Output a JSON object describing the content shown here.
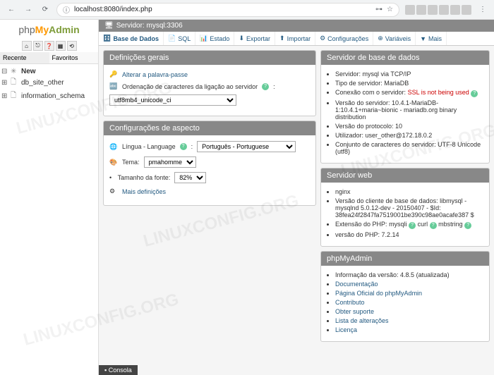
{
  "browser": {
    "url": "localhost:8080/index.php"
  },
  "logo": {
    "php": "php",
    "my": "My",
    "admin": "Admin"
  },
  "sidebar_tabs": {
    "recent": "Recente",
    "favorites": "Favoritos"
  },
  "tree": {
    "new": "New",
    "db1": "db_site_other",
    "db2": "information_schema"
  },
  "server_header": "Servidor: mysql:3306",
  "menu": {
    "databases": "Base de Dados",
    "sql": "SQL",
    "status": "Estado",
    "export": "Exportar",
    "import": "Importar",
    "settings": "Configurações",
    "variables": "Variáveis",
    "more": "Mais"
  },
  "general": {
    "title": "Definições gerais",
    "change_password": "Alterar a palavra-passe",
    "collation_label": "Ordenação de caracteres da ligação ao servidor",
    "collation_value": "utf8mb4_unicode_ci"
  },
  "appearance": {
    "title": "Configurações de aspecto",
    "language_label": "Língua - Language",
    "language_value": "Português - Portuguese",
    "theme_label": "Tema:",
    "theme_value": "pmahomme",
    "fontsize_label": "Tamanho da fonte:",
    "fontsize_value": "82%",
    "more_settings": "Mais definições"
  },
  "dbserver": {
    "title": "Servidor de base de dados",
    "server": "Servidor: mysql via TCP/IP",
    "type": "Tipo de servidor: MariaDB",
    "connection_label": "Conexão com o servidor:",
    "ssl_warning": "SSL is not being used",
    "version": "Versão do servidor: 10.4.1-MariaDB-1:10.4.1+maria~bionic - mariadb.org binary distribution",
    "protocol": "Versão do protocolo: 10",
    "user": "Utilizador: user_other@172.18.0.2",
    "charset": "Conjunto de caracteres do servidor: UTF-8 Unicode (utf8)"
  },
  "webserver": {
    "title": "Servidor web",
    "nginx": "nginx",
    "client": "Versão do cliente de base de dados: libmysql - mysqlnd 5.0.12-dev - 20150407 - $Id: 38fea24f2847fa7519001be390c98ae0acafe387 $",
    "ext_label": "Extensão do PHP:",
    "ext1": "mysqli",
    "ext2": "curl",
    "ext3": "mbstring",
    "php": "versão do PHP: 7.2.14"
  },
  "pma": {
    "title": "phpMyAdmin",
    "version": "Informação da versão: 4.8.5 (atualizada)",
    "docs": "Documentação",
    "homepage": "Página Oficial do phpMyAdmin",
    "contribute": "Contributo",
    "support": "Obter suporte",
    "changes": "Lista de alterações",
    "license": "Licença"
  },
  "console": "Consola",
  "watermark": "LINUXCONFIG.ORG"
}
